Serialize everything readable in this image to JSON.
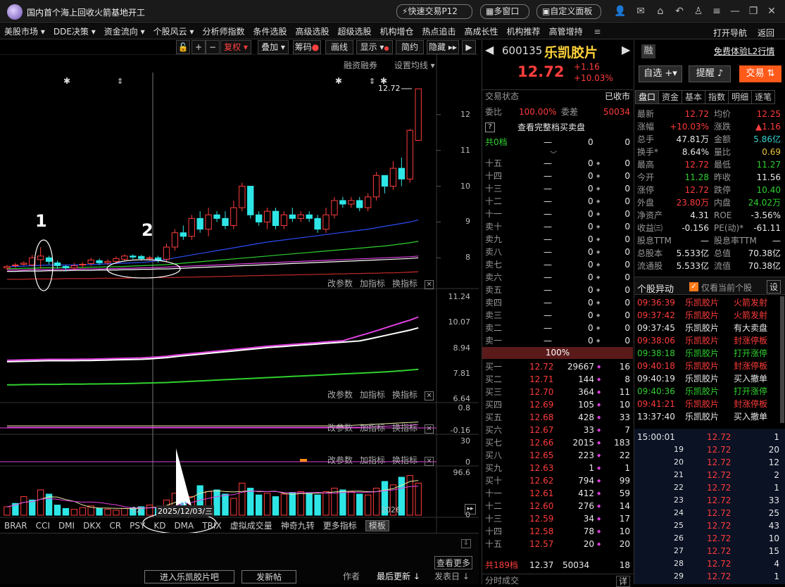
{
  "window": {
    "title": "国内首个海上回收火箭基地开工",
    "quick_trade": "快速交易P12",
    "multi_window": "多窗口",
    "custom_panel": "自定义面板"
  },
  "menu": [
    "美股市场",
    "DDE决策",
    "资金流向",
    "个股风云",
    "分析师指数",
    "条件选股",
    "高级选股",
    "超级选股",
    "机构增仓",
    "热点追击",
    "高成长性",
    "机构推荐",
    "高管增持"
  ],
  "menu_arrows": [
    true,
    true,
    true,
    true,
    false,
    false,
    false,
    false,
    false,
    false,
    false,
    false,
    false
  ],
  "menu_right": [
    "打开导航",
    "返回"
  ],
  "chart_toolbar": {
    "fuquan": "复权",
    "overlay": "叠加",
    "chips": "筹码",
    "draw": "画线",
    "display": "显示",
    "simple": "简约",
    "hide": "隐藏"
  },
  "main_panel": {
    "links": [
      "融资融券",
      "设置均线"
    ],
    "last_price_label": "12.72",
    "annotation_1": "1",
    "annotation_2": "2"
  },
  "panel_links": [
    "改参数",
    "加指标",
    "换指标"
  ],
  "time_axis": {
    "left": "12",
    "crosshair": "2025/12/03/三",
    "right": "2026"
  },
  "bottom_tabs": [
    "BRAR",
    "CCI",
    "DMI",
    "DKX",
    "CR",
    "PSY",
    "KD",
    "DMA",
    "TRIX",
    "虚拟成交量",
    "神奇九转",
    "更多指标",
    "模板"
  ],
  "footer": {
    "forum": "进入乐凯胶片吧",
    "post": "发新帖",
    "more": "查看更多",
    "author": "作者",
    "last_update": "最后更新",
    "post_date": "发表日"
  },
  "chart_data": [
    {
      "type": "candlestick",
      "ylim": [
        7.2,
        12.9
      ],
      "ticks": [
        12.0,
        11.0,
        10.0,
        9.0,
        8.0
      ],
      "candles": [
        [
          7.72,
          7.76,
          7.66,
          7.8
        ],
        [
          7.78,
          7.8,
          7.72,
          7.86
        ],
        [
          7.82,
          7.85,
          7.78,
          7.9
        ],
        [
          7.8,
          8.0,
          7.76,
          8.08
        ],
        [
          7.95,
          8.05,
          7.7,
          8.3
        ],
        [
          8.0,
          7.9,
          7.82,
          8.06
        ],
        [
          7.86,
          7.78,
          7.7,
          7.92
        ],
        [
          7.76,
          7.72,
          7.62,
          7.8
        ],
        [
          7.72,
          7.78,
          7.66,
          7.86
        ],
        [
          7.8,
          7.82,
          7.72,
          7.88
        ],
        [
          7.84,
          7.94,
          7.78,
          8.0
        ],
        [
          7.92,
          7.86,
          7.8,
          7.98
        ],
        [
          7.86,
          7.9,
          7.8,
          7.96
        ],
        [
          7.9,
          7.98,
          7.84,
          8.04
        ],
        [
          7.96,
          8.05,
          7.9,
          8.1
        ],
        [
          8.05,
          8.02,
          7.96,
          8.1
        ],
        [
          8.04,
          7.98,
          7.92,
          8.08
        ],
        [
          7.98,
          8.0,
          7.92,
          8.06
        ],
        [
          8.0,
          7.94,
          7.86,
          8.06
        ],
        [
          7.96,
          8.3,
          7.9,
          8.4
        ],
        [
          8.3,
          8.7,
          8.2,
          8.8
        ],
        [
          8.7,
          8.6,
          8.5,
          8.9
        ],
        [
          8.6,
          9.1,
          8.5,
          9.2
        ],
        [
          9.1,
          8.8,
          8.7,
          9.3
        ],
        [
          8.8,
          9.2,
          8.6,
          9.4
        ],
        [
          9.2,
          9.1,
          9.0,
          9.3
        ],
        [
          9.1,
          8.9,
          8.8,
          9.3
        ],
        [
          8.9,
          9.4,
          8.8,
          9.6
        ],
        [
          9.4,
          10.0,
          9.3,
          10.1
        ],
        [
          10.0,
          9.2,
          9.1,
          10.0
        ],
        [
          9.2,
          9.0,
          8.9,
          9.3
        ],
        [
          9.0,
          9.3,
          8.8,
          9.4
        ],
        [
          9.3,
          8.9,
          8.8,
          9.4
        ],
        [
          8.9,
          9.2,
          8.8,
          9.3
        ],
        [
          9.2,
          9.1,
          9.0,
          9.4
        ],
        [
          9.1,
          9.2,
          9.0,
          9.3
        ],
        [
          9.2,
          9.1,
          9.0,
          9.3
        ],
        [
          9.1,
          8.8,
          8.7,
          9.2
        ],
        [
          8.8,
          9.2,
          8.7,
          9.4
        ],
        [
          9.2,
          9.6,
          9.1,
          9.7
        ],
        [
          9.6,
          9.5,
          9.4,
          9.7
        ],
        [
          9.5,
          9.6,
          9.4,
          9.7
        ],
        [
          9.6,
          9.4,
          9.3,
          9.7
        ],
        [
          9.4,
          9.7,
          9.3,
          9.8
        ],
        [
          9.7,
          10.3,
          9.6,
          10.4
        ],
        [
          10.3,
          10.0,
          9.8,
          10.3
        ],
        [
          10.0,
          10.5,
          9.9,
          10.7
        ],
        [
          10.5,
          10.2,
          10.0,
          10.8
        ],
        [
          10.2,
          11.56,
          10.1,
          11.6
        ],
        [
          11.28,
          12.72,
          11.27,
          12.72
        ]
      ],
      "ma": [
        {
          "color": "#2b4cf5",
          "values": [
            7.75,
            7.76,
            7.77,
            7.78,
            7.79,
            7.8,
            7.8,
            7.8,
            7.8,
            7.81,
            7.81,
            7.82,
            7.83,
            7.84,
            7.85,
            7.86,
            7.87,
            7.89,
            7.92,
            7.95,
            8.0,
            8.04,
            8.08,
            8.12,
            8.16,
            8.2,
            8.24,
            8.28,
            8.32,
            8.36,
            8.4,
            8.44,
            8.47,
            8.5,
            8.53,
            8.56,
            8.59,
            8.62,
            8.65,
            8.68,
            8.71,
            8.74,
            8.77,
            8.8,
            8.84,
            8.88,
            8.92,
            8.96,
            9.0,
            9.06
          ]
        },
        {
          "color": "#2fd02f",
          "values": [
            7.7,
            7.7,
            7.71,
            7.71,
            7.72,
            7.72,
            7.72,
            7.73,
            7.73,
            7.73,
            7.74,
            7.74,
            7.75,
            7.75,
            7.76,
            7.77,
            7.78,
            7.79,
            7.8,
            7.81,
            7.83,
            7.85,
            7.87,
            7.89,
            7.91,
            7.93,
            7.95,
            7.97,
            7.99,
            8.01,
            8.03,
            8.05,
            8.07,
            8.09,
            8.11,
            8.13,
            8.15,
            8.17,
            8.19,
            8.21,
            8.23,
            8.25,
            8.27,
            8.29,
            8.31,
            8.33,
            8.36,
            8.39,
            8.42,
            8.46
          ]
        },
        {
          "color": "#e040e0",
          "values": [
            7.66,
            7.66,
            7.66,
            7.67,
            7.67,
            7.67,
            7.68,
            7.68,
            7.68,
            7.69,
            7.69,
            7.69,
            7.7,
            7.7,
            7.71,
            7.71,
            7.72,
            7.72,
            7.73,
            7.74,
            7.75,
            7.76,
            7.77,
            7.78,
            7.79,
            7.8,
            7.81,
            7.82,
            7.83,
            7.84,
            7.85,
            7.86,
            7.87,
            7.88,
            7.89,
            7.9,
            7.91,
            7.92,
            7.93,
            7.94,
            7.95,
            7.96,
            7.97,
            7.98,
            7.99,
            8.0,
            8.01,
            8.02,
            8.03,
            8.05
          ]
        },
        {
          "color": "#ffffff",
          "values": [
            7.62,
            7.62,
            7.63,
            7.63,
            7.63,
            7.64,
            7.64,
            7.64,
            7.65,
            7.65,
            7.65,
            7.66,
            7.66,
            7.66,
            7.67,
            7.67,
            7.68,
            7.68,
            7.69,
            7.69,
            7.7,
            7.71,
            7.72,
            7.73,
            7.74,
            7.75,
            7.76,
            7.77,
            7.78,
            7.79,
            7.8,
            7.81,
            7.82,
            7.83,
            7.84,
            7.85,
            7.86,
            7.87,
            7.88,
            7.89,
            7.9,
            7.91,
            7.92,
            7.93,
            7.94,
            7.95,
            7.96,
            7.97,
            7.98,
            8.0
          ]
        },
        {
          "color": "#cc2a2a",
          "values": [
            7.4,
            7.4,
            7.4,
            7.41,
            7.41,
            7.41,
            7.41,
            7.42,
            7.42,
            7.42,
            7.42,
            7.43,
            7.43,
            7.43,
            7.43,
            7.44,
            7.44,
            7.44,
            7.45,
            7.45,
            7.45,
            7.46,
            7.46,
            7.47,
            7.47,
            7.48,
            7.48,
            7.49,
            7.49,
            7.5,
            7.5,
            7.51,
            7.51,
            7.52,
            7.52,
            7.53,
            7.53,
            7.54,
            7.54,
            7.55,
            7.55,
            7.56,
            7.56,
            7.57,
            7.57,
            7.58,
            7.58,
            7.59,
            7.6,
            7.61
          ]
        }
      ]
    },
    {
      "type": "line",
      "ticks": [
        11.24,
        10.07,
        8.94,
        7.81,
        6.64
      ],
      "ylim": [
        6.4,
        11.4
      ]
    },
    {
      "type": "line",
      "ticks": [
        0.8,
        -0.16
      ]
    },
    {
      "type": "line",
      "ticks": [
        30.0,
        0.0
      ]
    },
    {
      "type": "bar",
      "ticks": [
        96.6,
        0.0
      ],
      "values": [
        10,
        14,
        22,
        18,
        30,
        25,
        12,
        8,
        7,
        9,
        11,
        8,
        7,
        6,
        8,
        9,
        10,
        12,
        9,
        18,
        26,
        30,
        22,
        35,
        28,
        30,
        25,
        20,
        38,
        32,
        24,
        26,
        22,
        25,
        27,
        28,
        26,
        24,
        28,
        32,
        30,
        28,
        25,
        24,
        32,
        40,
        36,
        45,
        47,
        38
      ],
      "up": [
        true,
        false,
        true,
        false,
        true,
        false,
        false,
        false,
        true,
        true,
        true,
        false,
        true,
        true,
        true,
        false,
        false,
        true,
        false,
        true,
        true,
        false,
        true,
        false,
        true,
        false,
        false,
        true,
        true,
        false,
        false,
        true,
        false,
        true,
        false,
        true,
        false,
        false,
        true,
        true,
        false,
        true,
        false,
        true,
        true,
        false,
        true,
        false,
        true,
        true
      ]
    }
  ],
  "quote": {
    "code": "600135",
    "name": "乐凯胶片",
    "price": "12.72",
    "change": "+1.16",
    "change_pct": "+10.03%",
    "badge": "融",
    "l2": "免费体验L2行情",
    "favorite": "自选",
    "alert": "提醒",
    "trade": "交易",
    "trade_status_label": "交易状态",
    "trade_status_value": "已收市",
    "weibi_label": "委比",
    "weibi_value": "100.00%",
    "weicha_label": "委差",
    "weicha_value": "50034",
    "view_full": "查看完整档买卖盘",
    "total_sell": "共0档",
    "pct_bar": "100%",
    "sell": [
      [
        "十五",
        "—",
        "0"
      ],
      [
        "十四",
        "—",
        "0"
      ],
      [
        "十三",
        "—",
        "0"
      ],
      [
        "十二",
        "—",
        "0"
      ],
      [
        "十一",
        "—",
        "0"
      ],
      [
        "卖十",
        "—",
        "0"
      ],
      [
        "卖九",
        "—",
        "0"
      ],
      [
        "卖八",
        "—",
        "0"
      ],
      [
        "卖七",
        "—",
        "0"
      ],
      [
        "卖六",
        "—",
        "0"
      ],
      [
        "卖五",
        "—",
        "0"
      ],
      [
        "卖四",
        "—",
        "0"
      ],
      [
        "卖三",
        "—",
        "0"
      ],
      [
        "卖二",
        "—",
        "0"
      ],
      [
        "卖一",
        "—",
        "0"
      ]
    ],
    "buy": [
      [
        "买一",
        "12.72",
        "29667",
        "16"
      ],
      [
        "买二",
        "12.71",
        "144",
        "8"
      ],
      [
        "买三",
        "12.70",
        "364",
        "11"
      ],
      [
        "买四",
        "12.69",
        "105",
        "10"
      ],
      [
        "买五",
        "12.68",
        "428",
        "33"
      ],
      [
        "买六",
        "12.67",
        "33",
        "7"
      ],
      [
        "买七",
        "12.66",
        "2015",
        "183"
      ],
      [
        "买八",
        "12.65",
        "223",
        "22"
      ],
      [
        "买九",
        "12.63",
        "1",
        "1"
      ],
      [
        "买十",
        "12.62",
        "794",
        "99"
      ],
      [
        "十一",
        "12.61",
        "412",
        "59"
      ],
      [
        "十二",
        "12.60",
        "276",
        "14"
      ],
      [
        "十三",
        "12.59",
        "34",
        "17"
      ],
      [
        "十四",
        "12.58",
        "78",
        "10"
      ],
      [
        "十五",
        "12.57",
        "20",
        "20"
      ]
    ],
    "total_buy": [
      "共189档",
      "12.37",
      "50034",
      "18"
    ],
    "minute_trade": "分时成交",
    "detail": "详"
  },
  "right_panel": {
    "tabs": [
      "盘口",
      "资金",
      "基本",
      "指数",
      "明细",
      "逐笔"
    ],
    "stats": [
      [
        "最新",
        "12.72",
        "均价",
        "12.25"
      ],
      [
        "涨幅",
        "+10.03%",
        "涨跌",
        "▲1.16"
      ],
      [
        "总手",
        "47.81万",
        "金额",
        "5.86亿"
      ],
      [
        "换手*",
        "8.64%",
        "量比",
        "0.69"
      ],
      [
        "最高",
        "12.72",
        "最低",
        "11.27"
      ],
      [
        "今开",
        "11.28",
        "昨收",
        "11.56"
      ],
      [
        "涨停",
        "12.72",
        "跌停",
        "10.40"
      ],
      [
        "外盘",
        "23.80万",
        "内盘",
        "24.02万"
      ],
      [
        "净资产",
        "4.31",
        "ROE",
        "-3.56%"
      ],
      [
        "收益㈢",
        "-0.156",
        "PE(动)*",
        "-61.11"
      ],
      [
        "股息TTM",
        "—",
        "股息率TTM",
        "—"
      ],
      [
        "总股本",
        "5.533亿",
        "总值",
        "70.38亿"
      ],
      [
        "流通股",
        "5.533亿",
        "流值",
        "70.38亿"
      ]
    ],
    "stat_colors": [
      [
        "red",
        "red"
      ],
      [
        "red",
        "red"
      ],
      [
        "white",
        "cyan"
      ],
      [
        "white",
        "yellow"
      ],
      [
        "red",
        "green"
      ],
      [
        "green",
        "white"
      ],
      [
        "red",
        "green"
      ],
      [
        "red",
        "green"
      ],
      [
        "white",
        "white"
      ],
      [
        "white",
        "white"
      ],
      [
        "white",
        "white"
      ],
      [
        "white",
        "white"
      ],
      [
        "white",
        "white"
      ]
    ],
    "anomaly_title": "个股异动",
    "only_current": "仅看当前个股",
    "settings": "设",
    "anomalies": [
      [
        "09:36:39",
        "乐凯胶片",
        "火箭发射",
        "red"
      ],
      [
        "09:37:42",
        "乐凯胶片",
        "火箭发射",
        "red"
      ],
      [
        "09:37:45",
        "乐凯胶片",
        "有大卖盘",
        "white"
      ],
      [
        "09:38:06",
        "乐凯胶片",
        "封涨停板",
        "red"
      ],
      [
        "09:38:18",
        "乐凯胶片",
        "打开涨停",
        "green"
      ],
      [
        "09:40:18",
        "乐凯胶片",
        "封涨停板",
        "red"
      ],
      [
        "09:40:19",
        "乐凯胶片",
        "买入撤单",
        "white"
      ],
      [
        "09:40:36",
        "乐凯胶片",
        "打开涨停",
        "green"
      ],
      [
        "09:41:21",
        "乐凯胶片",
        "封涨停板",
        "red"
      ],
      [
        "13:37:40",
        "乐凯胶片",
        "买入撤单",
        "white"
      ]
    ],
    "ticks": [
      [
        "15:00:01",
        "12.72",
        "1"
      ],
      [
        "19",
        "12.72",
        "20"
      ],
      [
        "20",
        "12.72",
        "12"
      ],
      [
        "21",
        "12.72",
        "2"
      ],
      [
        "22",
        "12.72",
        "1"
      ],
      [
        "23",
        "12.72",
        "33"
      ],
      [
        "24",
        "12.72",
        "25"
      ],
      [
        "25",
        "12.72",
        "43"
      ],
      [
        "26",
        "12.72",
        "10"
      ],
      [
        "27",
        "12.72",
        "15"
      ],
      [
        "28",
        "12.72",
        "4"
      ],
      [
        "29",
        "12.72",
        "1"
      ]
    ]
  }
}
